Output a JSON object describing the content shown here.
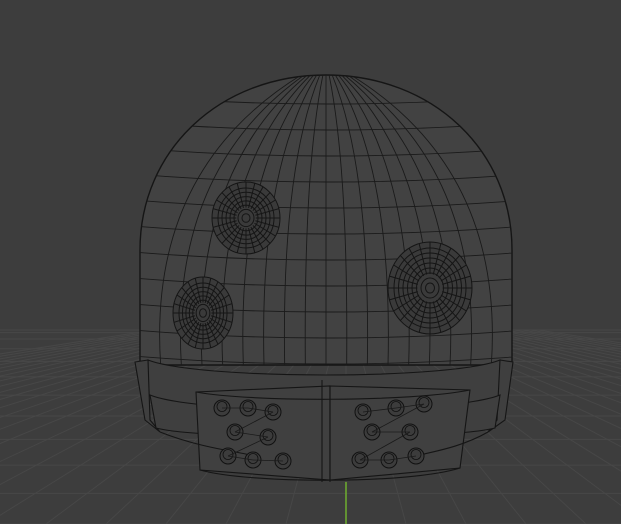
{
  "viewport": {
    "background": "#3d3d3d",
    "floor_grid": true,
    "axis_color_y": "#6fae2f",
    "wire_color": "#111111"
  },
  "model": {
    "name": "",
    "shading": "wireframe",
    "parts": [
      "dome",
      "left-upper-vent",
      "left-lower-vent",
      "right-vent",
      "base-ring",
      "bolt-cluster-left",
      "bolt-cluster-right"
    ]
  }
}
